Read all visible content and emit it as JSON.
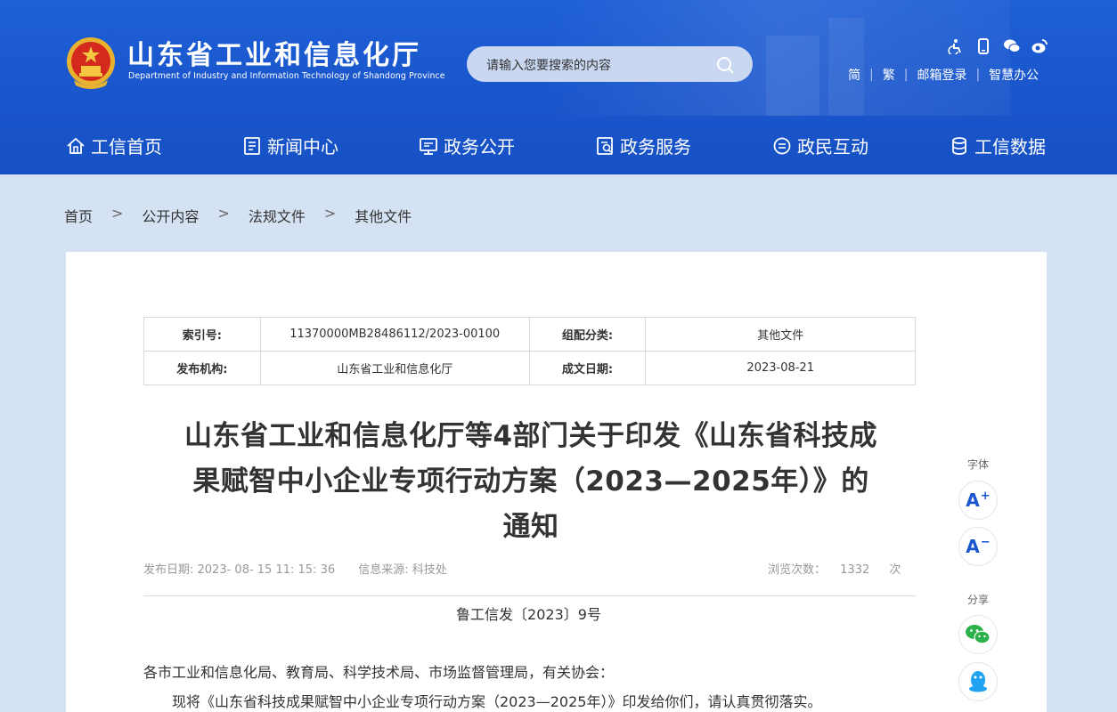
{
  "header": {
    "title": "山东省工业和信息化厅",
    "subtitle": "Department of Industry and Information Technology of Shandong Province",
    "search_placeholder": "请输入您要搜索的内容",
    "util_links": [
      "简",
      "繁",
      "邮箱登录",
      "智慧办公"
    ],
    "util_icons": [
      "accessibility-icon",
      "mobile-icon",
      "wechat-icon",
      "weibo-icon"
    ],
    "brand_color": "#1a56cc"
  },
  "nav": {
    "items": [
      {
        "label": "工信首页",
        "icon": "home-icon"
      },
      {
        "label": "新闻中心",
        "icon": "news-icon"
      },
      {
        "label": "政务公开",
        "icon": "monitor-icon"
      },
      {
        "label": "政务服务",
        "icon": "service-icon"
      },
      {
        "label": "政民互动",
        "icon": "chat-icon"
      },
      {
        "label": "工信数据",
        "icon": "database-icon"
      }
    ]
  },
  "breadcrumb": {
    "items": [
      "首页",
      "公开内容",
      "法规文件",
      "其他文件"
    ],
    "separator": ">"
  },
  "meta": {
    "index_label": "索引号:",
    "index_value": "11370000MB28486112/2023-00100",
    "category_label": "组配分类:",
    "category_value": "其他文件",
    "publisher_label": "发布机构:",
    "publisher_value": "山东省工业和信息化厅",
    "date_label": "成文日期:",
    "date_value": "2023-08-21"
  },
  "article": {
    "title_line1": "山东省工业和信息化厅等4部门关于印发《山东省科技成",
    "title_line2": "果赋智中小企业专项行动方案（2023—2025年）》的",
    "title_line3": "通知",
    "publish_date": "发布日期: 2023- 08- 15 11: 15: 36",
    "source": "信息来源: 科技处",
    "views_label": "浏览次数：",
    "views_count": "1332",
    "views_unit": "次",
    "doc_number": "鲁工信发〔2023〕9号",
    "paragraph1": "各市工业和信息化局、教育局、科学技术局、市场监督管理局，有关协会：",
    "paragraph2": "现将《山东省科技成果赋智中小企业专项行动方案（2023—2025年）》印发给你们，请认真贯彻落实。"
  },
  "side_tools": {
    "font_label": "字体",
    "font_increase": "A",
    "font_increase_sup": "+",
    "font_decrease": "A",
    "font_decrease_sup": "−",
    "share_label": "分享"
  }
}
